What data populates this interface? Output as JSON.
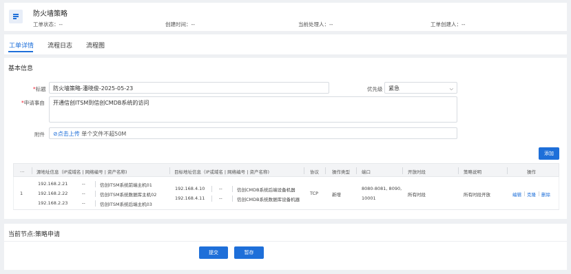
{
  "header": {
    "title": "防火墙策略",
    "meta": [
      {
        "label": "工单状态：",
        "value": "--"
      },
      {
        "label": "创建时间：",
        "value": "--"
      },
      {
        "label": "当前处理人：",
        "value": "--"
      },
      {
        "label": "工单创建人：",
        "value": "--"
      }
    ]
  },
  "tabs": [
    "工单详情",
    "流程日志",
    "流程图"
  ],
  "basic": {
    "section_title": "基本信息",
    "title_label": "标题",
    "title_value": "防火墙策略-潘晓俊-2025-05-23",
    "priority_label": "优先级",
    "priority_value": "紧急",
    "reason_label": "申请事由",
    "reason_value": "开通信创ITSM到信创CMDB系统的访问",
    "attach_label": "附件",
    "upload_link": "⊘点击上传",
    "upload_tip": "单个文件不超50M",
    "add_button": "添加"
  },
  "table": {
    "headers": [
      "…",
      "源地址信息（IP或域名 | 网络编号 | 资产名称)",
      "目标地址信息（IP或域名 | 网络编号 | 资产名称)",
      "协议",
      "操作类型",
      "端口",
      "开放时段",
      "策略说明",
      "操作"
    ],
    "row": {
      "index": "1",
      "sources": [
        {
          "ip": "192.168.2.21",
          "net": "--",
          "name": "信创ITSM系统前端主机01"
        },
        {
          "ip": "192.168.2.22",
          "net": "--",
          "name": "信创ITSM系统数据库主机02"
        },
        {
          "ip": "192.168.2.23",
          "net": "--",
          "name": "信创ITSM系统后端主机03"
        }
      ],
      "targets": [
        {
          "ip": "192.168.4.10",
          "net": "--",
          "name": "信创CMDB系统后端设备机器"
        },
        {
          "ip": "192.168.4.11",
          "net": "--",
          "name": "信创CMDB系统数据库设备机器"
        }
      ],
      "protocol": "TCP",
      "op_type": "新增",
      "port_line1": "8080-8081, 8090,",
      "port_line2": "10001",
      "open_time": "所有时段",
      "policy_desc": "所有时段开放",
      "actions": [
        "编辑",
        "克隆",
        "删除"
      ]
    }
  },
  "footer": {
    "node_title": "当前节点:策略申请",
    "submit": "提交",
    "save": "暂存"
  },
  "colors": {
    "accent": "#1e6fd9",
    "required": "#e22233"
  }
}
